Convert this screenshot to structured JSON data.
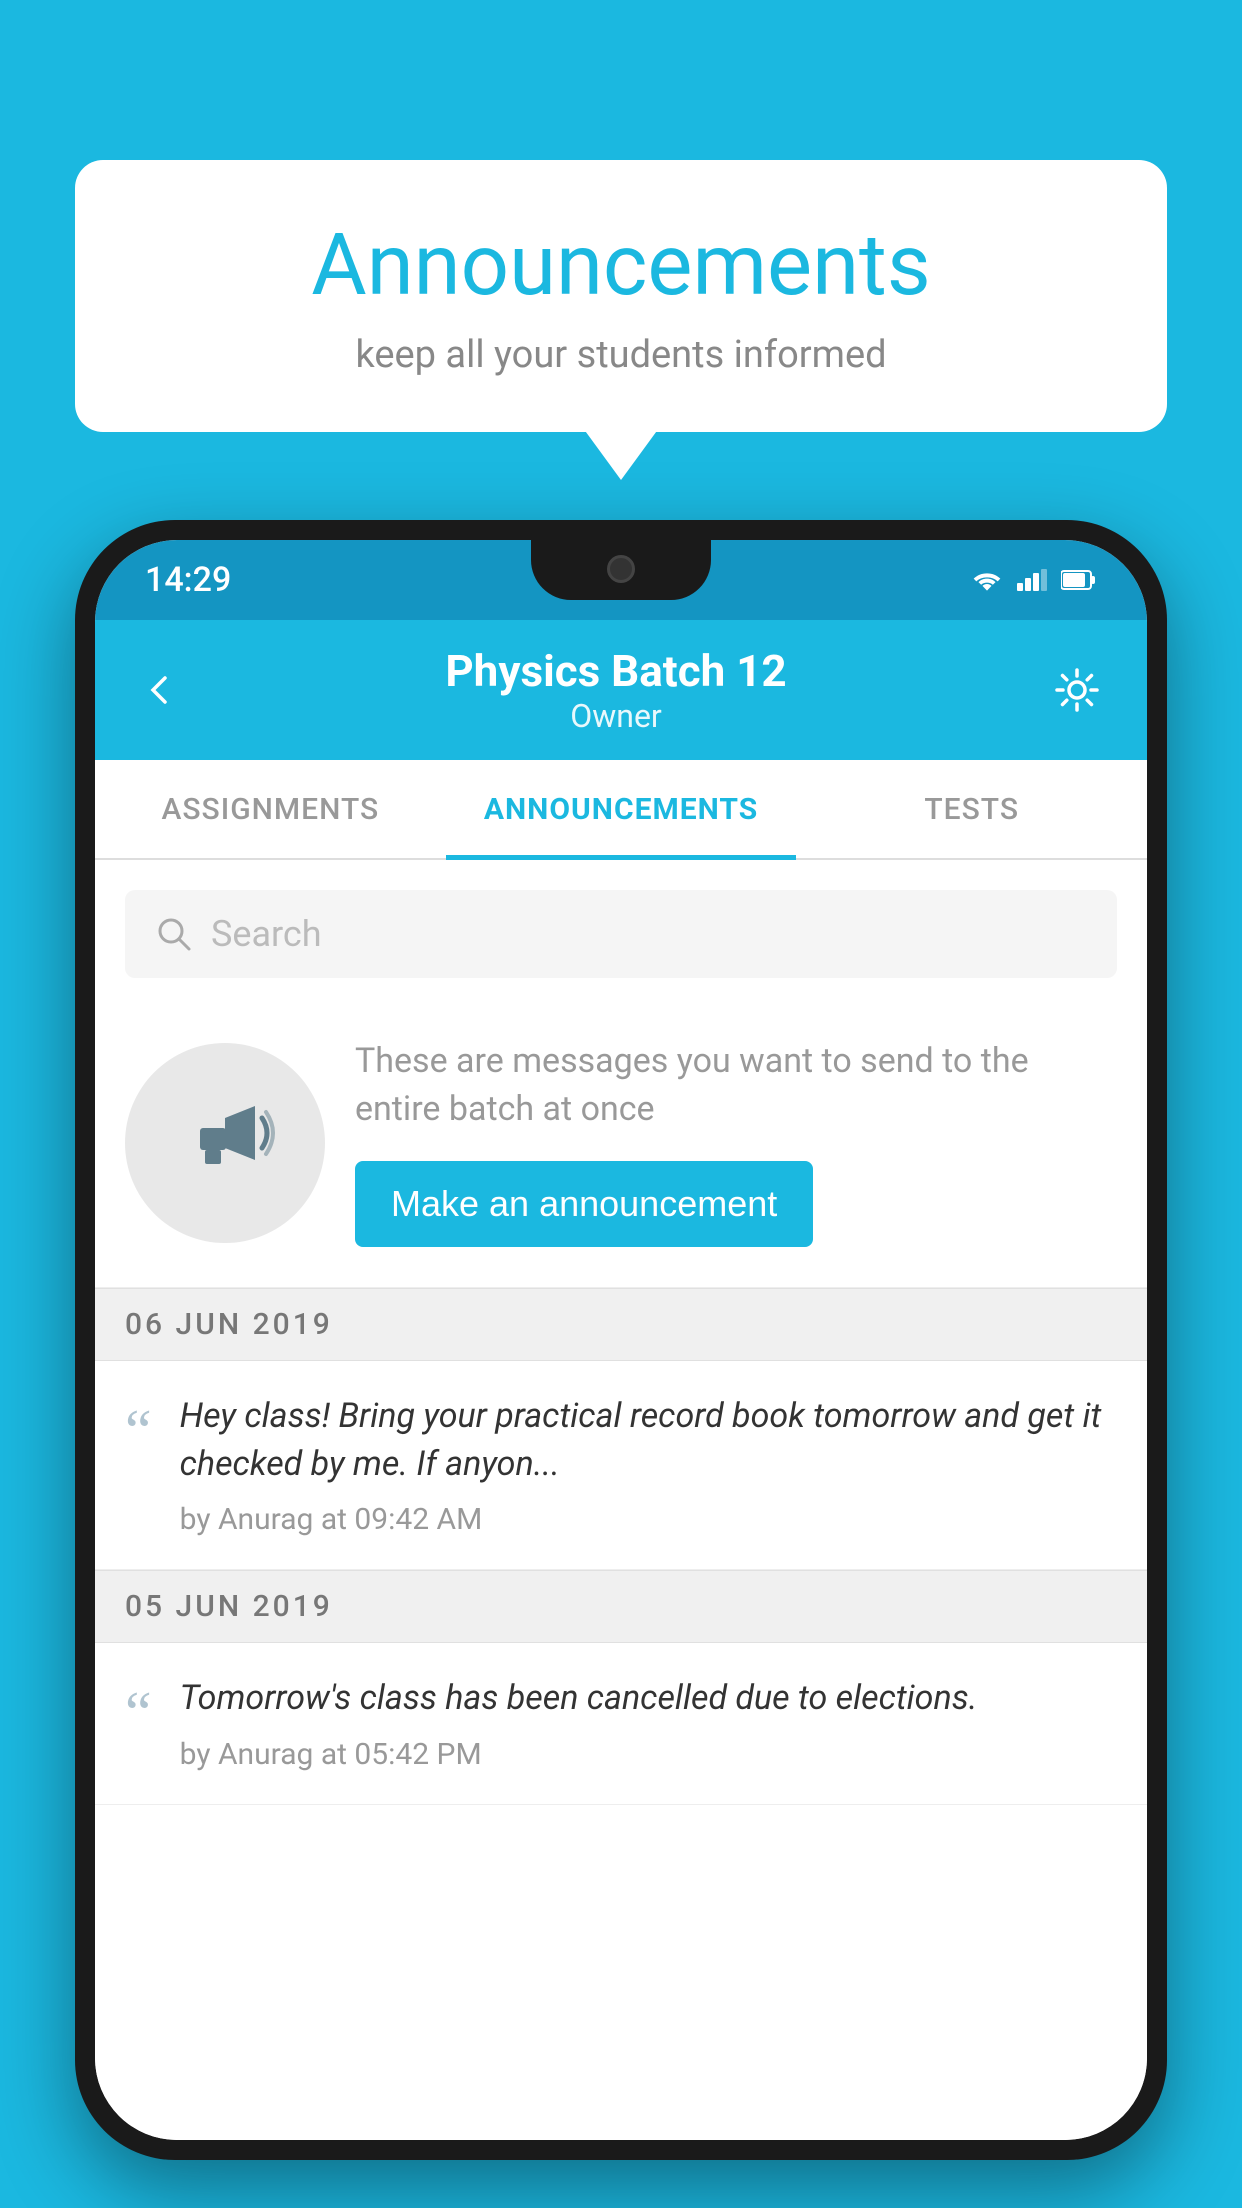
{
  "background_color": "#1bb8e0",
  "speech_bubble": {
    "title": "Announcements",
    "subtitle": "keep all your students informed"
  },
  "phone": {
    "status_bar": {
      "time": "14:29"
    },
    "app_bar": {
      "title": "Physics Batch 12",
      "subtitle": "Owner",
      "back_label": "back",
      "settings_label": "settings"
    },
    "tabs": [
      {
        "label": "ASSIGNMENTS",
        "active": false
      },
      {
        "label": "ANNOUNCEMENTS",
        "active": true
      },
      {
        "label": "TESTS",
        "active": false
      }
    ],
    "search": {
      "placeholder": "Search"
    },
    "empty_state": {
      "description": "These are messages you want to send to the entire batch at once",
      "cta_label": "Make an announcement"
    },
    "announcements": [
      {
        "date": "06  JUN  2019",
        "text": "Hey class! Bring your practical record book tomorrow and get it checked by me. If anyon...",
        "author": "by Anurag at 09:42 AM"
      },
      {
        "date": "05  JUN  2019",
        "text": "Tomorrow's class has been cancelled due to elections.",
        "author": "by Anurag at 05:42 PM"
      }
    ]
  }
}
